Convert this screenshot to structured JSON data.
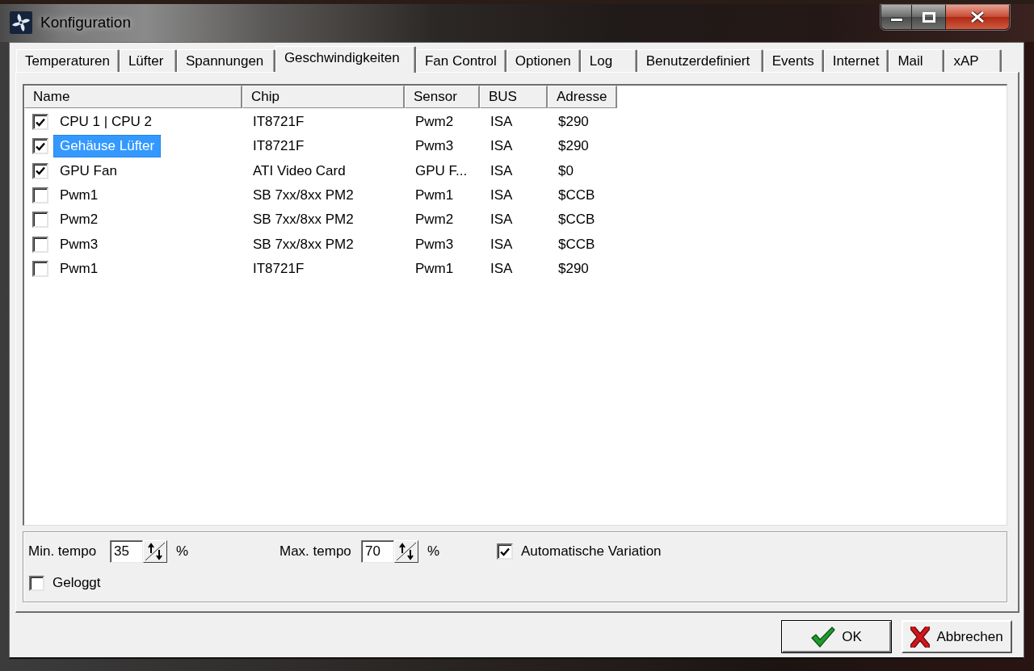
{
  "window": {
    "title": "Konfiguration"
  },
  "tabs": [
    {
      "label": "Temperaturen",
      "selected": false
    },
    {
      "label": "Lüfter",
      "selected": false
    },
    {
      "label": "Spannungen",
      "selected": false
    },
    {
      "label": "Geschwindigkeiten",
      "selected": true
    },
    {
      "label": "Fan Control",
      "selected": false
    },
    {
      "label": "Optionen",
      "selected": false
    },
    {
      "label": "Log",
      "selected": false
    },
    {
      "label": "Benutzerdefiniert",
      "selected": false
    },
    {
      "label": "Events",
      "selected": false
    },
    {
      "label": "Internet",
      "selected": false
    },
    {
      "label": "Mail",
      "selected": false
    },
    {
      "label": "xAP",
      "selected": false
    }
  ],
  "table": {
    "columns": [
      "Name",
      "Chip",
      "Sensor",
      "BUS",
      "Adresse"
    ],
    "rows": [
      {
        "checked": true,
        "selected": false,
        "cells": [
          "CPU 1 | CPU 2",
          "IT8721F",
          "Pwm2",
          "ISA",
          "$290"
        ]
      },
      {
        "checked": true,
        "selected": true,
        "cells": [
          "Gehäuse Lüfter",
          "IT8721F",
          "Pwm3",
          "ISA",
          "$290"
        ]
      },
      {
        "checked": true,
        "selected": false,
        "cells": [
          "GPU Fan",
          "ATI Video Card",
          "GPU F...",
          "ISA",
          "$0"
        ]
      },
      {
        "checked": false,
        "selected": false,
        "cells": [
          "Pwm1",
          "SB 7xx/8xx PM2",
          "Pwm1",
          "ISA",
          "$CCB"
        ]
      },
      {
        "checked": false,
        "selected": false,
        "cells": [
          "Pwm2",
          "SB 7xx/8xx PM2",
          "Pwm2",
          "ISA",
          "$CCB"
        ]
      },
      {
        "checked": false,
        "selected": false,
        "cells": [
          "Pwm3",
          "SB 7xx/8xx PM2",
          "Pwm3",
          "ISA",
          "$CCB"
        ]
      },
      {
        "checked": false,
        "selected": false,
        "cells": [
          "Pwm1",
          "IT8721F",
          "Pwm1",
          "ISA",
          "$290"
        ]
      }
    ]
  },
  "settings": {
    "spinners": [
      {
        "label": "Min. tempo",
        "value": "35",
        "unit": "%"
      },
      {
        "label": "Max. tempo",
        "value": "70",
        "unit": "%"
      }
    ],
    "checkboxes": [
      {
        "label": "Automatische Variation",
        "checked": true
      },
      {
        "label": "Geloggt",
        "checked": false
      }
    ]
  },
  "buttons": [
    {
      "kind": "ok",
      "label": "OK"
    },
    {
      "kind": "cancel",
      "label": "Abbrechen"
    }
  ]
}
